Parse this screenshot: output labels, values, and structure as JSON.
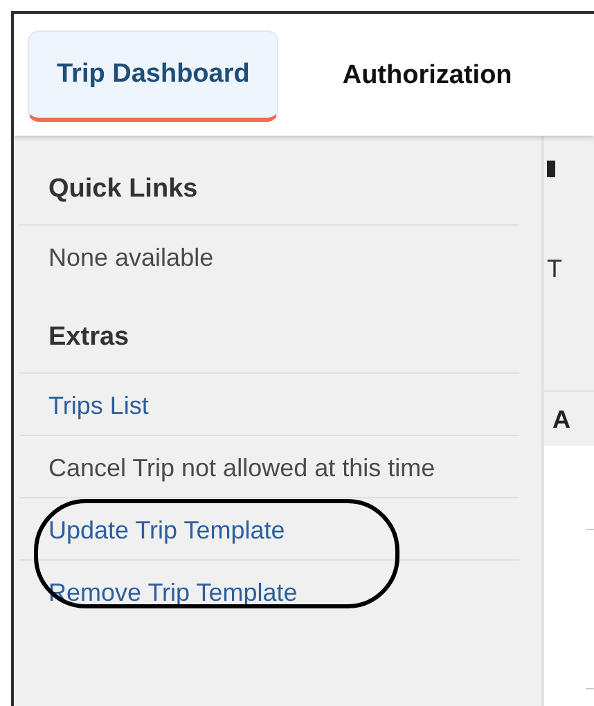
{
  "tabs": [
    {
      "label": "Trip Dashboard",
      "selected": true
    },
    {
      "label": "Authorization",
      "selected": false
    }
  ],
  "sidebar": {
    "sections": [
      {
        "heading": "Quick Links",
        "items": [
          {
            "label": "None available",
            "kind": "note"
          }
        ]
      },
      {
        "heading": "Extras",
        "items": [
          {
            "label": "Trips List",
            "kind": "link"
          },
          {
            "label": "Cancel Trip not allowed at this time",
            "kind": "note"
          },
          {
            "label": "Update Trip Template",
            "kind": "link"
          },
          {
            "label": "Remove Trip Template",
            "kind": "link"
          }
        ]
      }
    ]
  },
  "content": {
    "column_1": "T",
    "column_2": "A"
  }
}
